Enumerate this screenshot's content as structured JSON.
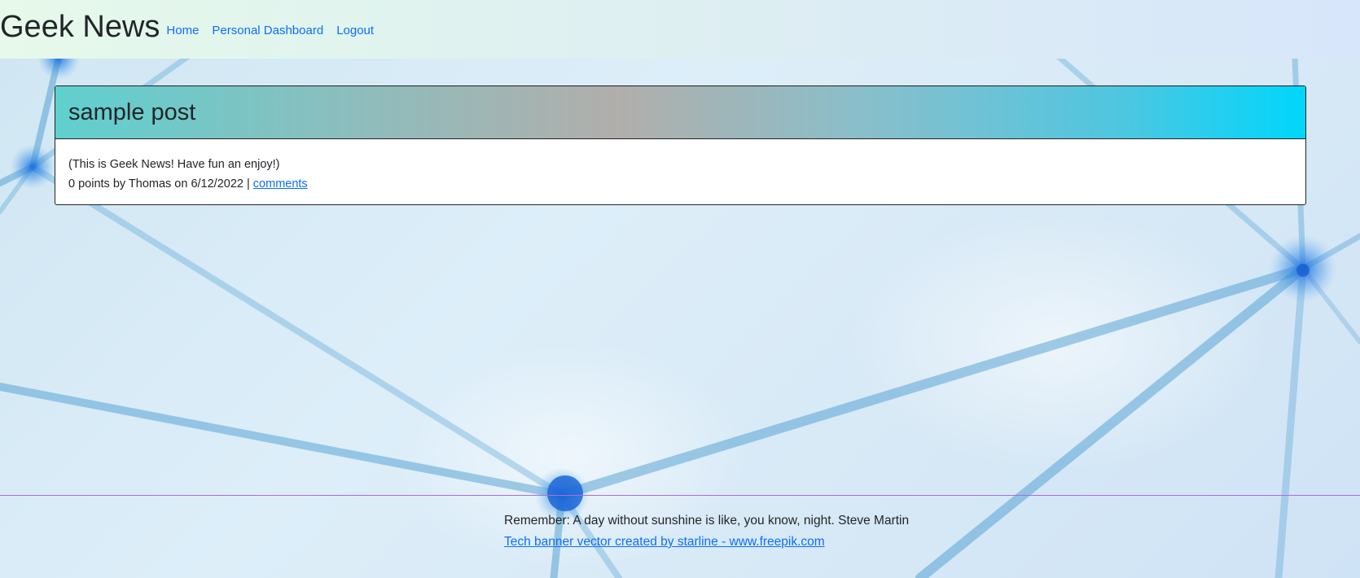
{
  "navbar": {
    "brand": "Geek News",
    "links": [
      "Home",
      "Personal Dashboard",
      "Logout"
    ]
  },
  "post": {
    "title": "sample post",
    "text": "(This is Geek News! Have fun an enjoy!)",
    "meta": "0 points by Thomas on 6/12/2022 |",
    "comments_link": "comments"
  },
  "footer": {
    "quote": "Remember: A day without sunshine is like, you know, night. Steve Martin",
    "credit_link": "Tech banner vector created by starline - www.freepik.com"
  },
  "colors": {
    "link": "#0d6efd",
    "header_gradient_start": "#5fd0cf",
    "header_gradient_end": "#00d6fc",
    "footer_line": "#b06ad8"
  }
}
